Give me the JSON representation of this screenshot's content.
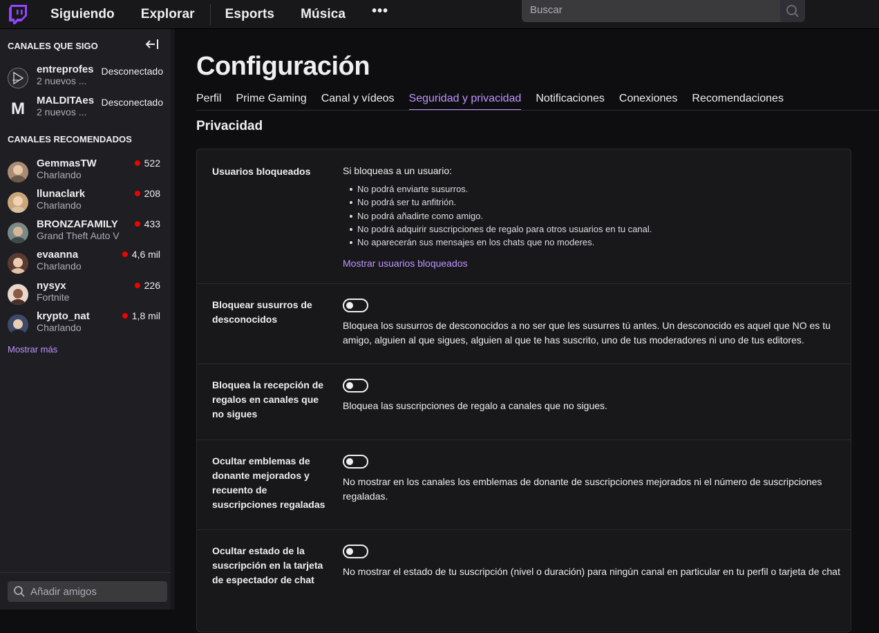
{
  "nav": {
    "items": [
      "Siguiendo",
      "Explorar",
      "Esports",
      "Música"
    ],
    "more": "•••",
    "search_placeholder": "Buscar"
  },
  "sidebar": {
    "followed_title": "CANALES QUE SIGO",
    "followed": [
      {
        "name": "entreprofes",
        "sub": "2 nuevos ...",
        "status": "Desconectado"
      },
      {
        "name": "MALDITAes",
        "sub": "2 nuevos ...",
        "status": "Desconectado"
      }
    ],
    "recommended_title": "CANALES RECOMENDADOS",
    "recommended": [
      {
        "name": "GemmasTW",
        "sub": "Charlando",
        "viewers": "522"
      },
      {
        "name": "llunaclark",
        "sub": "Charlando",
        "viewers": "208"
      },
      {
        "name": "BRONZAFAMILY",
        "sub": "Grand Theft Auto V",
        "viewers": "433"
      },
      {
        "name": "evaanna",
        "sub": "Charlando",
        "viewers": "4,6 mil"
      },
      {
        "name": "nysyx",
        "sub": "Fortnite",
        "viewers": "226"
      },
      {
        "name": "krypto_nat",
        "sub": "Charlando",
        "viewers": "1,8 mil"
      }
    ],
    "show_more": "Mostrar más",
    "add_friends_placeholder": "Añadir amigos"
  },
  "main": {
    "title": "Configuración",
    "tabs": [
      "Perfil",
      "Prime Gaming",
      "Canal y vídeos",
      "Seguridad y privacidad",
      "Notificaciones",
      "Conexiones",
      "Recomendaciones"
    ],
    "active_tab": "Seguridad y privacidad",
    "section_title": "Privacidad",
    "blocked": {
      "label": "Usuarios bloqueados",
      "intro": "Si bloqueas a un usuario:",
      "bullets": [
        "No podrá enviarte susurros.",
        "No podrá ser tu anfitrión.",
        "No podrá añadirte como amigo.",
        "No podrá adquirir suscripciones de regalo para otros usuarios en tu canal.",
        "No aparecerán sus mensajes en los chats que no moderes."
      ],
      "link": "Mostrar usuarios bloqueados"
    },
    "settings": [
      {
        "label": "Bloquear susurros de desconocidos",
        "desc": "Bloquea los susurros de desconocidos a no ser que les susurres tú antes. Un desconocido es aquel que NO es tu amigo, alguien al que sigues, alguien al que te has suscrito, uno de tus moderadores ni uno de tus editores.",
        "enabled": false
      },
      {
        "label": "Bloquea la recepción de regalos en canales que no sigues",
        "desc": "Bloquea las suscripciones de regalo a canales que no sigues.",
        "enabled": false
      },
      {
        "label": "Ocultar emblemas de donante mejorados y recuento de suscripciones regaladas",
        "desc": "No mostrar en los canales los emblemas de donante de suscripciones mejorados ni el número de suscripciones regaladas.",
        "enabled": false
      },
      {
        "label": "Ocultar estado de la suscripción en la tarjeta de espectador de chat",
        "desc": "No mostrar el estado de tu suscripción (nivel o duración) para ningún canal en particular en tu perfil o tarjeta de chat",
        "enabled": false
      }
    ]
  },
  "colors": {
    "accent": "#bf94ff",
    "brand": "#9147ff",
    "live": "#eb0400"
  }
}
